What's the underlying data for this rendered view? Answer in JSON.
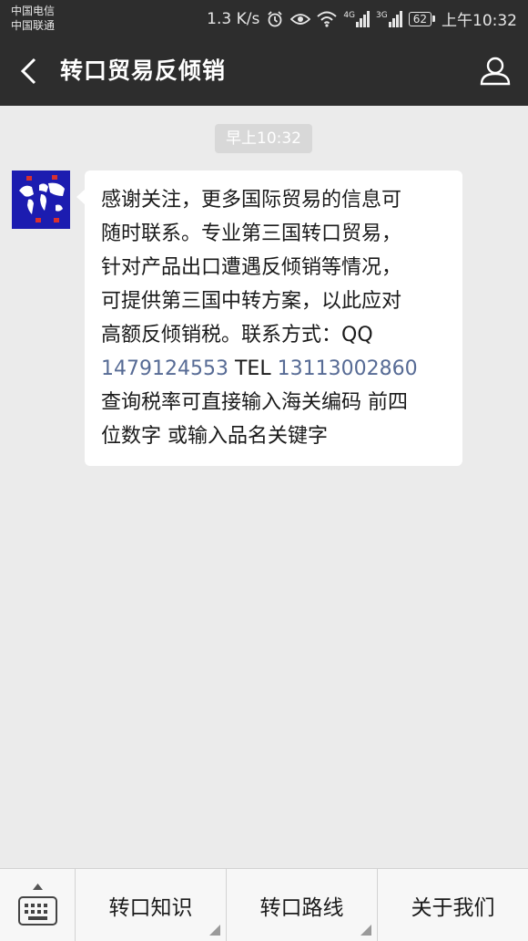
{
  "status_bar": {
    "carrier_1": "中国电信",
    "carrier_2": "中国联通",
    "speed": "1.3 K/s",
    "net_4g": "4G",
    "net_3g": "3G",
    "battery": "62",
    "time": "上午10:32"
  },
  "header": {
    "title": "转口贸易反倾销",
    "back_icon": "back-arrow-icon",
    "profile_icon": "person-icon"
  },
  "chat": {
    "timestamp": "早上10:32",
    "message": {
      "line1": "感谢关注，更多国际贸易的信息可",
      "line2": "随时联系。专业第三国转口贸易，",
      "line3": "针对产品出口遭遇反倾销等情况，",
      "line4": "可提供第三国中转方案，以此应对",
      "line5": "高额反倾销税。联系方式：QQ",
      "qq": "1479124553",
      "tel_label": "TEL",
      "tel": "13113002860",
      "line7": "查询税率可直接输入海关编码 前四",
      "line8": "位数字 或输入品名关键字"
    },
    "link_color": "#576b95"
  },
  "bottom_menu": {
    "keyboard_icon": "keyboard-icon",
    "items": [
      {
        "label": "转口知识"
      },
      {
        "label": "转口路线"
      },
      {
        "label": "关于我们"
      }
    ]
  }
}
